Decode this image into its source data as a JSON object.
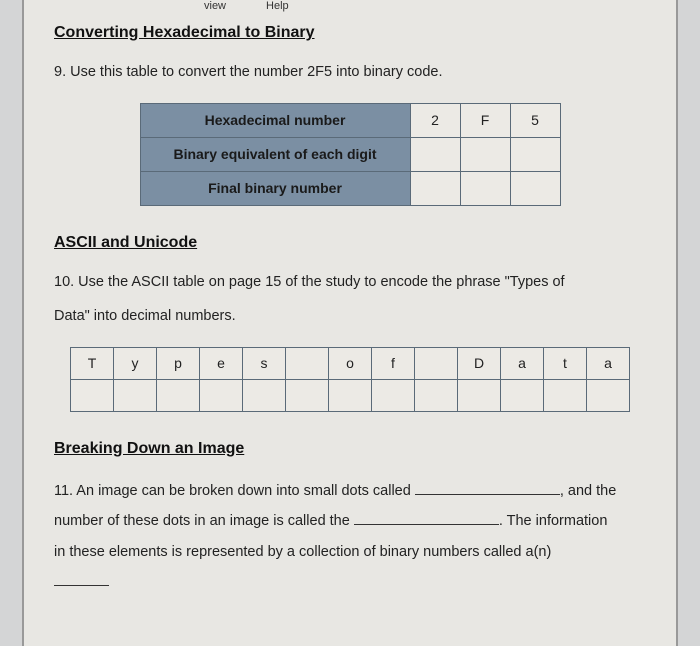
{
  "topbar": {
    "item1": "view",
    "item2": "Help"
  },
  "section1_title": "Converting Hexadecimal to Binary",
  "q9": {
    "text": "9. Use this table to convert the number 2F5 into binary code.",
    "row1_label": "Hexadecimal number",
    "row1_vals": [
      "2",
      "F",
      "5"
    ],
    "row2_label": "Binary equivalent of each digit",
    "row2_vals": [
      "",
      "",
      ""
    ],
    "row3_label": "Final binary number",
    "row3_vals": [
      "",
      "",
      ""
    ]
  },
  "section2_title": "ASCII and Unicode",
  "q10": {
    "text_a": "10. Use the ASCII table on page 15 of the study to encode the phrase \"Types of",
    "text_b": "Data\" into decimal numbers.",
    "chars": [
      "T",
      "y",
      "p",
      "e",
      "s",
      "",
      "o",
      "f",
      "",
      "D",
      "a",
      "t",
      "a"
    ],
    "answers": [
      "",
      "",
      "",
      "",
      "",
      "",
      "",
      "",
      "",
      "",
      "",
      "",
      ""
    ]
  },
  "section3_title": "Breaking Down an Image",
  "q11": {
    "part1": "11. An image can be broken down into small dots called ",
    "part2": ", and the",
    "part3": "number of these dots in an image is called the ",
    "part4": ". The information",
    "part5": "in these elements is represented by a collection of binary numbers called a(n)"
  }
}
